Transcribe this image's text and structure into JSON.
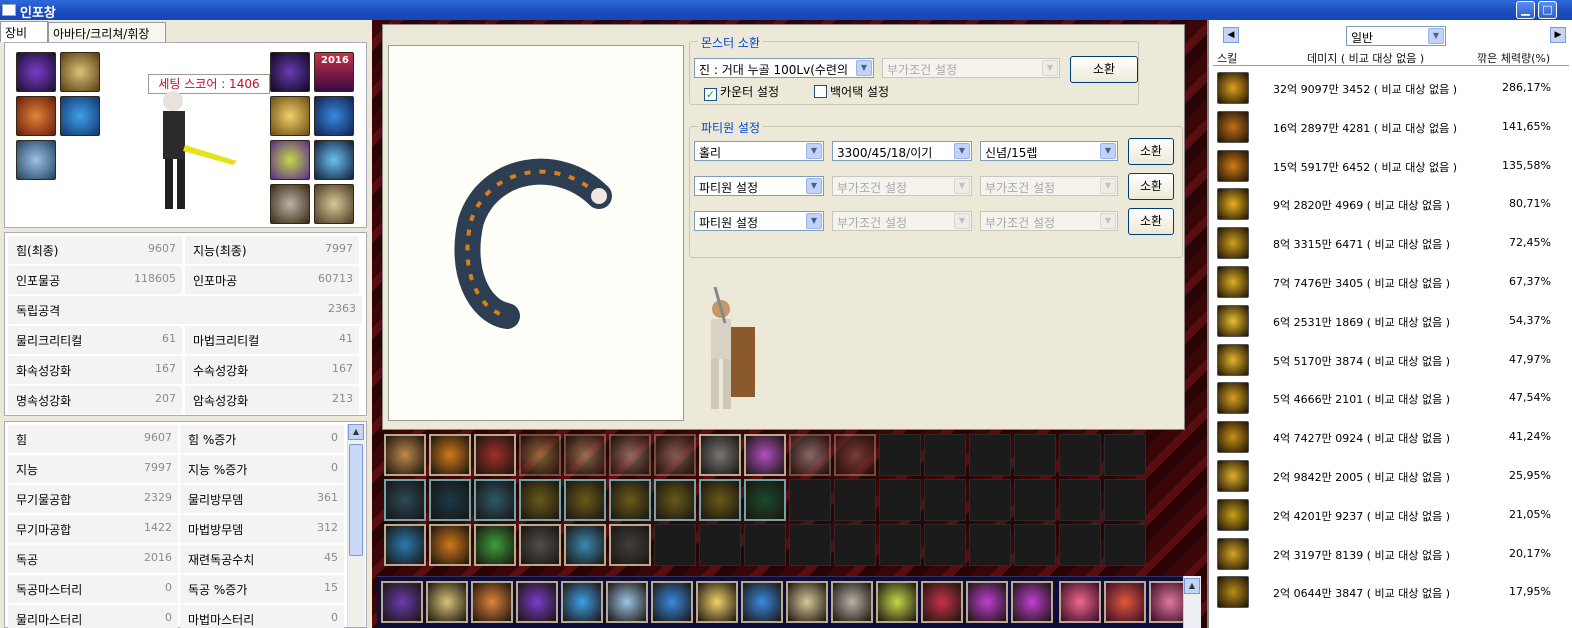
{
  "window": {
    "title": "인포창"
  },
  "tabs": [
    "장비",
    "아바타/크리쳐/휘장"
  ],
  "equipment": {
    "score": "세팅 스코어 : 1406",
    "badge_2016": "2016"
  },
  "final_stats": [
    [
      "힘(최종)",
      "9607",
      "지능(최종)",
      "7997"
    ],
    [
      "인포물공",
      "118605",
      "인포마공",
      "60713"
    ],
    [
      "독립공격",
      "2363",
      "",
      ""
    ],
    [
      "물리크리티컬",
      "61",
      "마법크리티컬",
      "41"
    ],
    [
      "화속성강화",
      "167",
      "수속성강화",
      "167"
    ],
    [
      "명속성강화",
      "207",
      "암속성강화",
      "213"
    ]
  ],
  "detail_stats": [
    [
      "힘",
      "9607",
      "힘 %증가",
      "0"
    ],
    [
      "지능",
      "7997",
      "지능 %증가",
      "0"
    ],
    [
      "무기물공합",
      "2329",
      "물리방무뎀",
      "361"
    ],
    [
      "무기마공합",
      "1422",
      "마법방무뎀",
      "312"
    ],
    [
      "독공",
      "2016",
      "재련독공수치",
      "45"
    ],
    [
      "독공마스터리",
      "0",
      "독공 %증가",
      "15"
    ],
    [
      "물리마스터리",
      "0",
      "마법마스터리",
      "0"
    ]
  ],
  "monster": {
    "group_label": "몬스터 소환",
    "selected": "진 : 거대 누골 100Lv(수련의",
    "extra": "부가조건 설정",
    "summon": "소환",
    "counter_label": "카운터 설정",
    "backattack_label": "백어택 설정"
  },
  "party": {
    "group_label": "파티원 설정",
    "rows": [
      [
        "홀리",
        "3300/45/18/이기",
        "신념/15렙",
        "소환"
      ],
      [
        "파티원 설정",
        "부가조건 설정",
        "부가조건 설정",
        "소환"
      ],
      [
        "파티원 설정",
        "부가조건 설정",
        "부가조건 설정",
        "소환"
      ]
    ]
  },
  "skills_panel": {
    "filter": "일반",
    "headers": [
      "스킬",
      "데미지 ( 비교 대상 없음 )",
      "깎은 체력량(%)"
    ],
    "rows": [
      [
        "32억 9097만 3452 ( 비교 대상 없음 )",
        "286,17%"
      ],
      [
        "16억 2897만 4281 ( 비교 대상 없음 )",
        "141,65%"
      ],
      [
        "15억 5917만 6452 ( 비교 대상 없음 )",
        "135,58%"
      ],
      [
        "9억 2820만 4969 ( 비교 대상 없음 )",
        "80,71%"
      ],
      [
        "8억 3315만 6471 ( 비교 대상 없음 )",
        "72,45%"
      ],
      [
        "7억 7476만 3405 ( 비교 대상 없음 )",
        "67,37%"
      ],
      [
        "6억 2531만 1869 ( 비교 대상 없음 )",
        "54,37%"
      ],
      [
        "5억 5170만 3874 ( 비교 대상 없음 )",
        "47,97%"
      ],
      [
        "5억 4666만 2101 ( 비교 대상 없음 )",
        "47,54%"
      ],
      [
        "4억 7427만 0924 ( 비교 대상 없음 )",
        "41,24%"
      ],
      [
        "2억 9842만 2005 ( 비교 대상 없음 )",
        "25,95%"
      ],
      [
        "2억 4201만 9237 ( 비교 대상 없음 )",
        "21,05%"
      ],
      [
        "2억 3197만 8139 ( 비교 대상 없음 )",
        "20,17%"
      ],
      [
        "2억 0644만 3847 ( 비교 대상 없음 )",
        "17,95%"
      ]
    ]
  },
  "colors": {
    "titlebar": "#1e4fc0",
    "score_text": "#c0102a",
    "group_label": "#0046d5"
  }
}
